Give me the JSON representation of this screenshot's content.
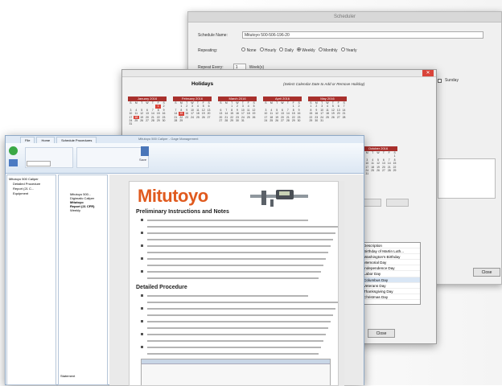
{
  "scheduler": {
    "title": "Scheduler",
    "schedule_name_label": "Schedule Name:",
    "schedule_name_value": "Mitutoyo 500-506-196-20",
    "repeating_label": "Repeating:",
    "repeat_options": [
      "None",
      "Hourly",
      "Daily",
      "Weekly",
      "Monthly",
      "Yearly"
    ],
    "repeat_selected": "Weekly",
    "repeat_every_label": "Repeat Every:",
    "repeat_every_value": "1",
    "repeat_every_unit": "Week(s)",
    "sunday_label": "Sunday",
    "close_label": "Close"
  },
  "holidays": {
    "title": "Holidays",
    "instruction": "(Select Calendar Date to Add or Remove Holiday)",
    "months": [
      "January 2016",
      "February 2016",
      "March 2016",
      "April 2016",
      "May 2016",
      "October 2016"
    ],
    "day_headers": [
      "S",
      "M",
      "T",
      "W",
      "T",
      "F",
      "S"
    ],
    "list_items": [
      "Description",
      "Birthday of Martin Luth...",
      "Washington's Birthday",
      "Memorial Day",
      "Independence Day",
      "Labor Day",
      "Columbus Day",
      "Veterans Day",
      "Thanksgiving Day",
      "Christmas Day"
    ],
    "close_label": "Close"
  },
  "editor": {
    "title": "Mitutoyo 500 Caliper - Gage Management",
    "tabs": [
      "File",
      "Home",
      "Schedule Procedures"
    ],
    "save_label": "Save",
    "brand": "Mitutoyo",
    "heading_preliminary": "Preliminary Instructions and Notes",
    "heading_detailed": "Detailed Procedure",
    "tree_items": [
      "Mitutoyo 500 Caliper",
      "Detailed Procedure",
      "Report (21 C...",
      "Equipment"
    ],
    "props": [
      "Mitutoyo 500...",
      "Digimatic Caliper",
      "Mitutoyo",
      "Report (21 CFR)",
      "Weekly"
    ],
    "status_label": "Statement"
  }
}
